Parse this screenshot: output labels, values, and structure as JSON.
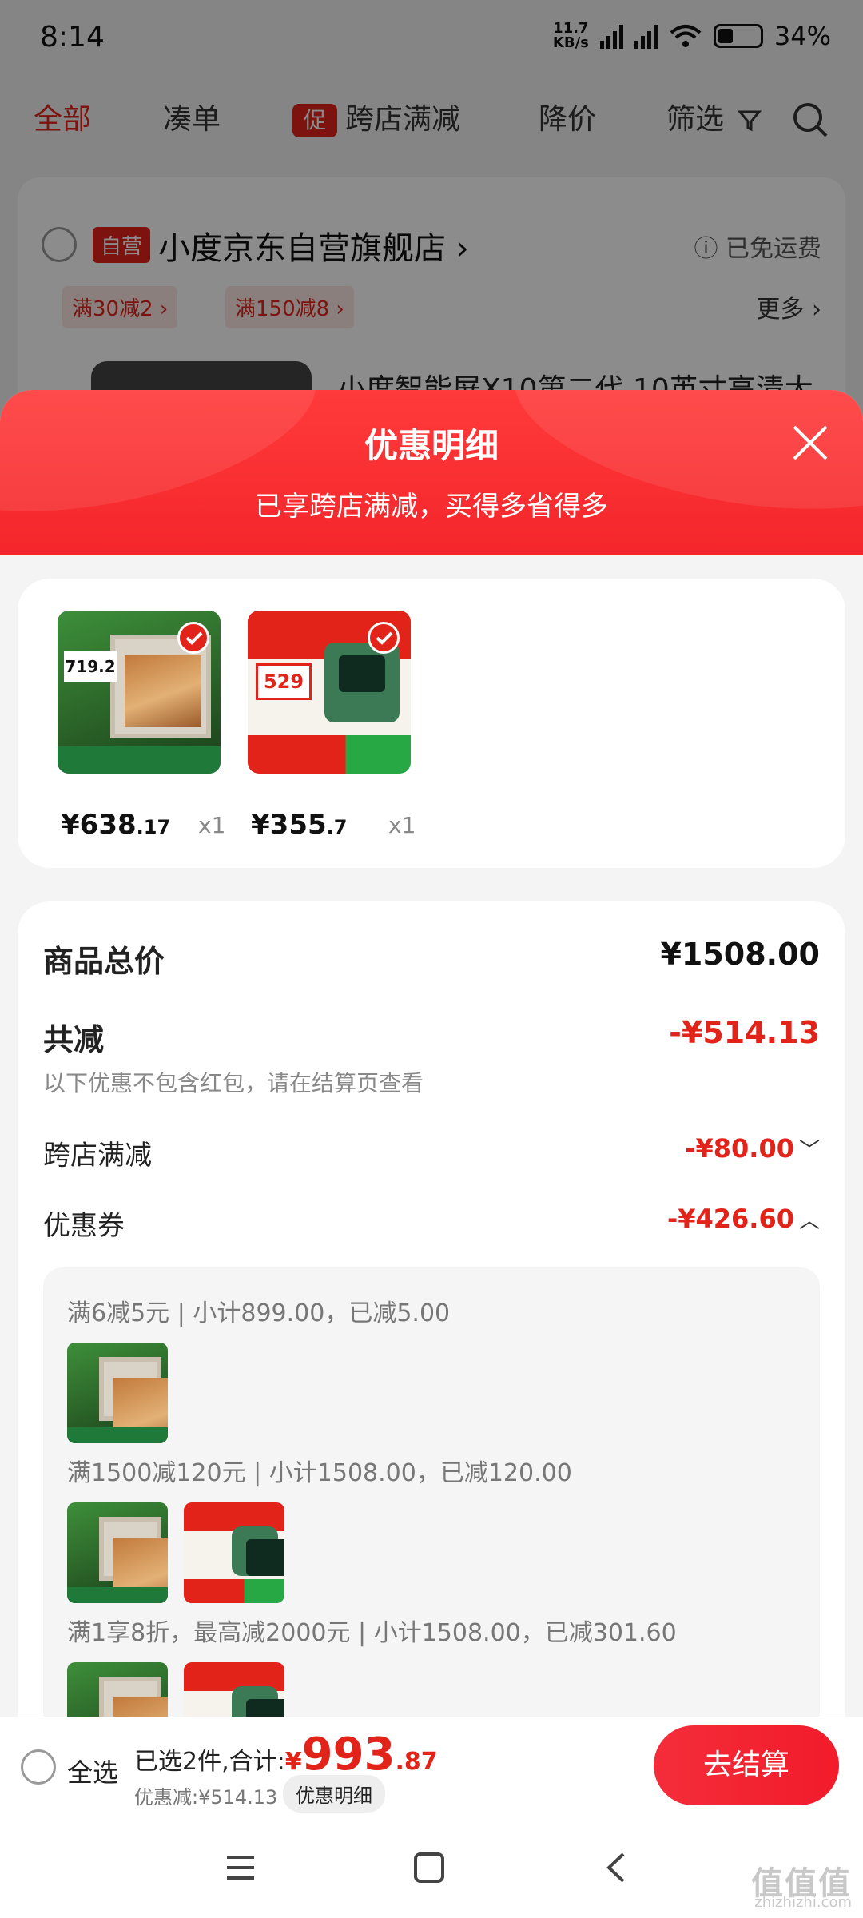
{
  "status_bar": {
    "time": "8:14",
    "net_speed_value": "11.7",
    "net_speed_unit": "KB/s",
    "battery": "34%"
  },
  "top_tabs": {
    "all": "全部",
    "bundle": "凑单",
    "promo_chip": "促",
    "cross_store": "跨店满减",
    "price_drop": "降价",
    "filter": "筛选"
  },
  "store": {
    "self_badge": "自营",
    "name": "小度京东自营旗舰店",
    "chevron": "›",
    "free_shipping": "ⓘ 已免运费",
    "coupons": [
      "满30减2 ›",
      "满150减8 ›"
    ],
    "more": "更多 ›",
    "product_title": "小度智能屏X10第二代 10英寸高清大"
  },
  "sheet": {
    "title": "优惠明细",
    "subtitle": "已享跨店满减，买得多省得多",
    "products": [
      {
        "price_int": "¥638",
        "price_dec": ".17",
        "qty": "x1",
        "thumb_tag": "719.2"
      },
      {
        "price_int": "¥355",
        "price_dec": ".7",
        "qty": "x1",
        "thumb_tag": "529"
      }
    ],
    "summary": {
      "total_label": "商品总价",
      "total_value": "¥1508.00",
      "discount_label": "共减",
      "discount_value": "-¥514.13",
      "note": "以下优惠不包含红包，请在结算页查看",
      "cross_store_label": "跨店满减",
      "cross_store_value": "-¥80.00",
      "cross_store_chevron": "﹀",
      "coupon_label": "优惠券",
      "coupon_value": "-¥426.60",
      "coupon_chevron": "︿"
    },
    "coupon_rules": [
      "满6减5元 | 小计899.00，已减5.00",
      "满1500减120元 | 小计1508.00，已减120.00",
      "满1享8折，最高减2000元 | 小计1508.00，已减301.60"
    ]
  },
  "bottom_bar": {
    "select_all": "全选",
    "selected_prefix": "已选2件,合计:",
    "total_currency": "¥",
    "total_int": "993",
    "total_dec": ".87",
    "saved": "优惠减:¥514.13",
    "detail_button": "优惠明细",
    "checkout_button": "去结算"
  },
  "watermark": {
    "main": "值值值",
    "sub": "zhizhizhi.com"
  },
  "colors": {
    "accent": "#e2231a",
    "sheet_header": "#f4262b"
  }
}
